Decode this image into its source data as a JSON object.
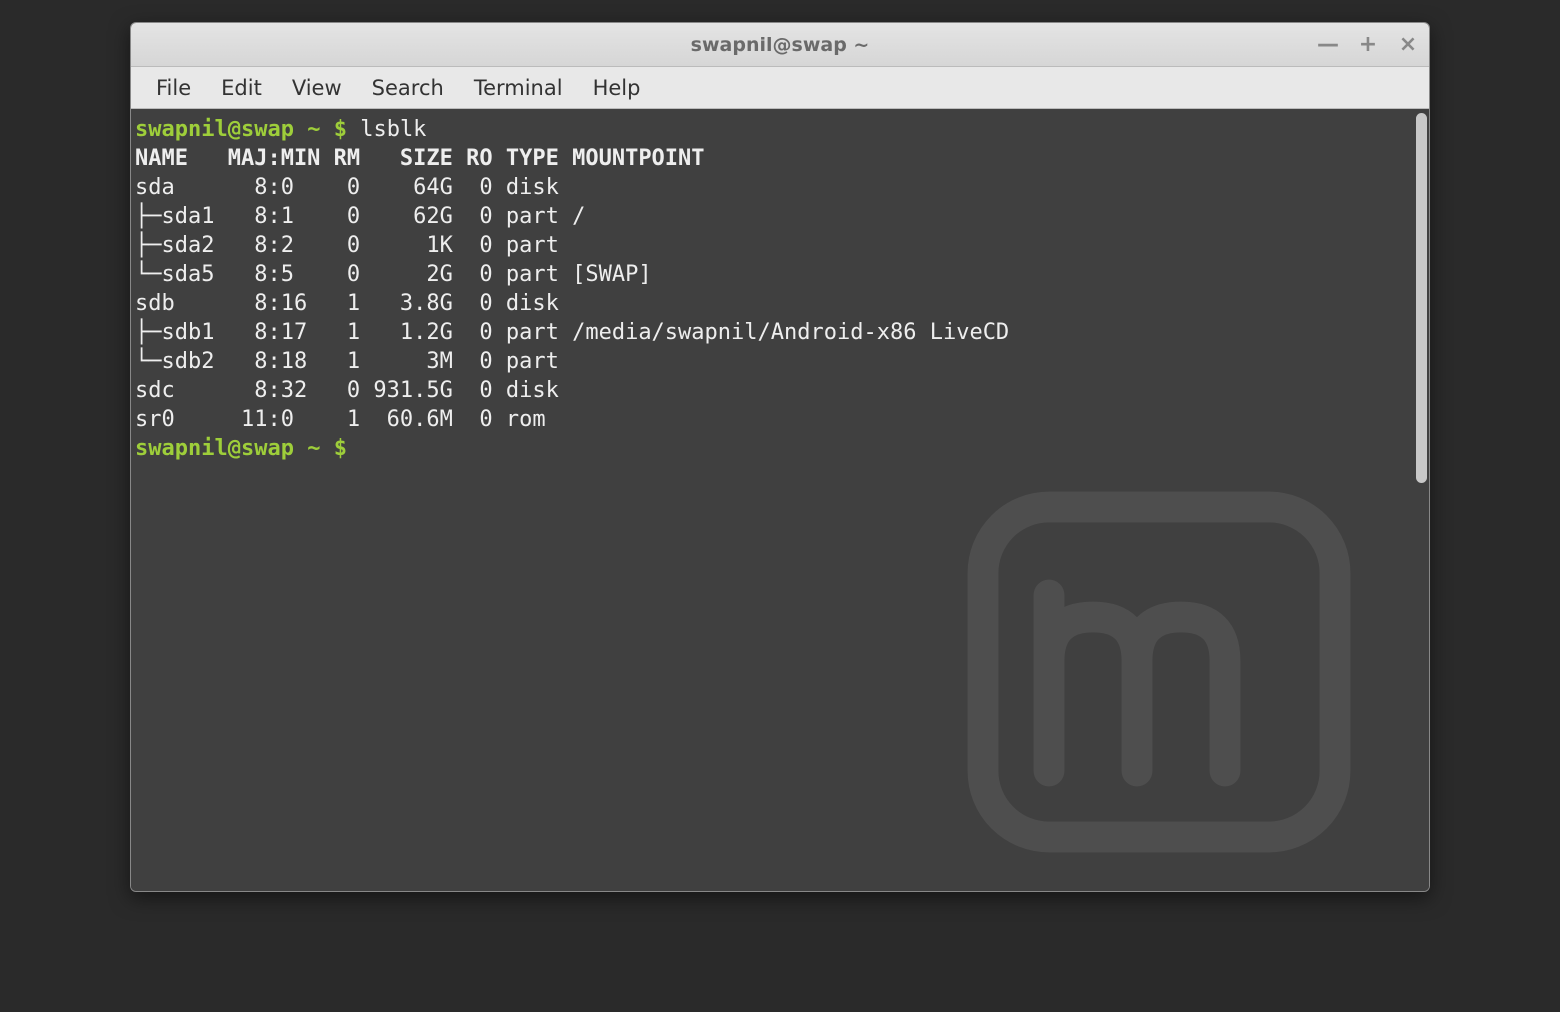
{
  "window": {
    "title": "swapnil@swap ~"
  },
  "menu": {
    "file": "File",
    "edit": "Edit",
    "view": "View",
    "search": "Search",
    "terminal": "Terminal",
    "help": "Help"
  },
  "prompt": {
    "userhost": "swapnil@swap",
    "path": "~",
    "symbol": "$"
  },
  "command": "lsblk",
  "header": "NAME   MAJ:MIN RM   SIZE RO TYPE MOUNTPOINT",
  "rows": {
    "r0": "sda      8:0    0    64G  0 disk ",
    "r1": "├─sda1   8:1    0    62G  0 part /",
    "r2": "├─sda2   8:2    0     1K  0 part ",
    "r3": "└─sda5   8:5    0     2G  0 part [SWAP]",
    "r4": "sdb      8:16   1   3.8G  0 disk ",
    "r5": "├─sdb1   8:17   1   1.2G  0 part /media/swapnil/Android-x86 LiveCD",
    "r6": "└─sdb2   8:18   1     3M  0 part ",
    "r7": "sdc      8:32   0 931.5G  0 disk ",
    "r8": "sr0     11:0    1  60.6M  0 rom  "
  },
  "titlebar_buttons": {
    "minimize": "—",
    "maximize": "+",
    "close": "×"
  }
}
